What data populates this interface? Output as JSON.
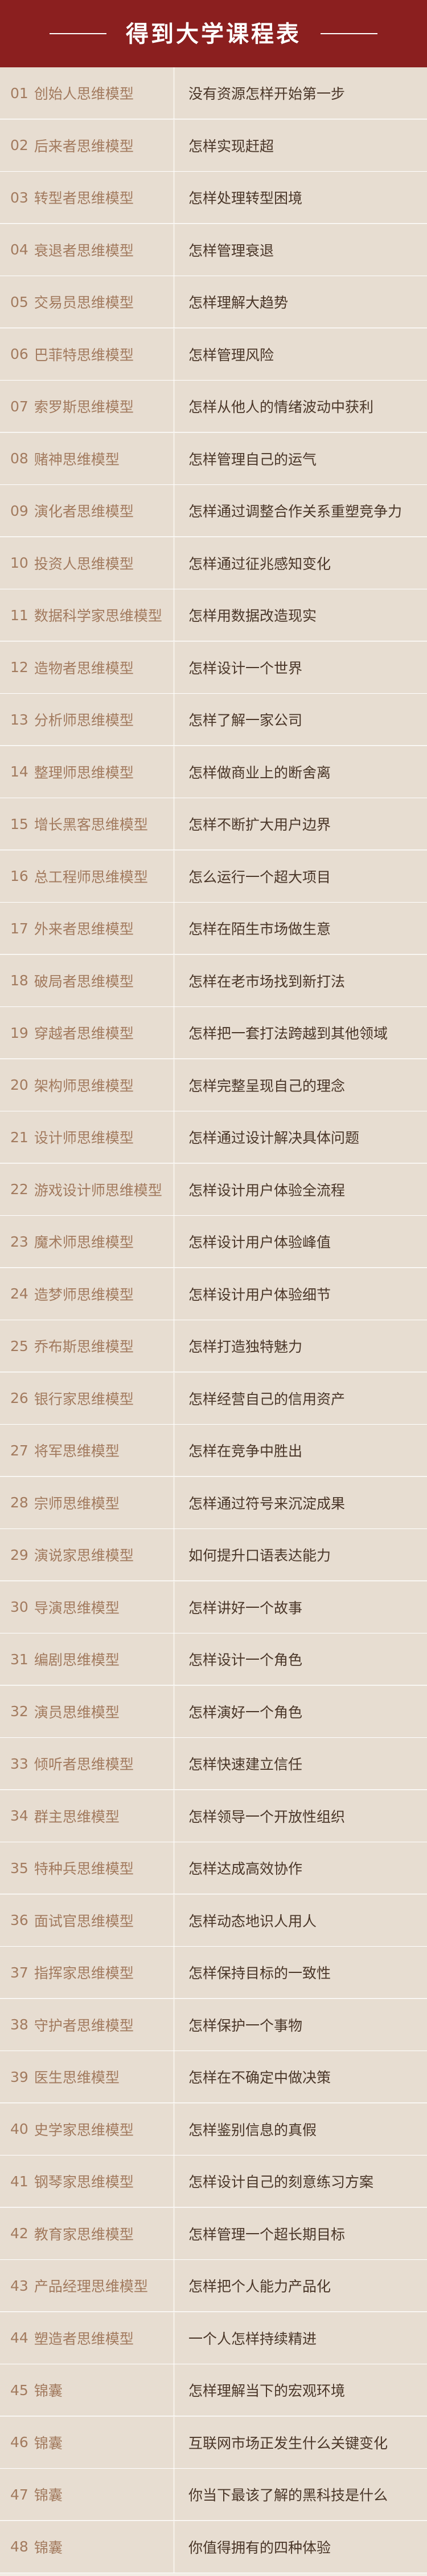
{
  "header": {
    "title": "得到大学课程表"
  },
  "courses": [
    {
      "num": "01",
      "model": "创始人思维模型",
      "desc": "没有资源怎样开始第一步"
    },
    {
      "num": "02",
      "model": "后来者思维模型",
      "desc": "怎样实现赶超"
    },
    {
      "num": "03",
      "model": "转型者思维模型",
      "desc": "怎样处理转型困境"
    },
    {
      "num": "04",
      "model": "衰退者思维模型",
      "desc": "怎样管理衰退"
    },
    {
      "num": "05",
      "model": "交易员思维模型",
      "desc": "怎样理解大趋势"
    },
    {
      "num": "06",
      "model": "巴菲特思维模型",
      "desc": "怎样管理风险"
    },
    {
      "num": "07",
      "model": "索罗斯思维模型",
      "desc": "怎样从他人的情绪波动中获利"
    },
    {
      "num": "08",
      "model": "赌神思维模型",
      "desc": "怎样管理自己的运气"
    },
    {
      "num": "09",
      "model": "演化者思维模型",
      "desc": "怎样通过调整合作关系重塑竞争力"
    },
    {
      "num": "10",
      "model": "投资人思维模型",
      "desc": "怎样通过征兆感知变化"
    },
    {
      "num": "11",
      "model": "数据科学家思维模型",
      "desc": "怎样用数据改造现实"
    },
    {
      "num": "12",
      "model": "造物者思维模型",
      "desc": "怎样设计一个世界"
    },
    {
      "num": "13",
      "model": "分析师思维模型",
      "desc": "怎样了解一家公司"
    },
    {
      "num": "14",
      "model": "整理师思维模型",
      "desc": "怎样做商业上的断舍离"
    },
    {
      "num": "15",
      "model": "增长黑客思维模型",
      "desc": "怎样不断扩大用户边界"
    },
    {
      "num": "16",
      "model": "总工程师思维模型",
      "desc": "怎么运行一个超大项目"
    },
    {
      "num": "17",
      "model": "外来者思维模型",
      "desc": "怎样在陌生市场做生意"
    },
    {
      "num": "18",
      "model": "破局者思维模型",
      "desc": "怎样在老市场找到新打法"
    },
    {
      "num": "19",
      "model": "穿越者思维模型",
      "desc": "怎样把一套打法跨越到其他领域"
    },
    {
      "num": "20",
      "model": "架构师思维模型",
      "desc": "怎样完整呈现自己的理念"
    },
    {
      "num": "21",
      "model": "设计师思维模型",
      "desc": "怎样通过设计解决具体问题"
    },
    {
      "num": "22",
      "model": "游戏设计师思维模型",
      "desc": "怎样设计用户体验全流程"
    },
    {
      "num": "23",
      "model": "魔术师思维模型",
      "desc": "怎样设计用户体验峰值"
    },
    {
      "num": "24",
      "model": "造梦师思维模型",
      "desc": "怎样设计用户体验细节"
    },
    {
      "num": "25",
      "model": "乔布斯思维模型",
      "desc": "怎样打造独特魅力"
    },
    {
      "num": "26",
      "model": "银行家思维模型",
      "desc": "怎样经营自己的信用资产"
    },
    {
      "num": "27",
      "model": "将军思维模型",
      "desc": "怎样在竞争中胜出"
    },
    {
      "num": "28",
      "model": "宗师思维模型",
      "desc": "怎样通过符号来沉淀成果"
    },
    {
      "num": "29",
      "model": "演说家思维模型",
      "desc": "如何提升口语表达能力"
    },
    {
      "num": "30",
      "model": "导演思维模型",
      "desc": "怎样讲好一个故事"
    },
    {
      "num": "31",
      "model": "编剧思维模型",
      "desc": "怎样设计一个角色"
    },
    {
      "num": "32",
      "model": "演员思维模型",
      "desc": "怎样演好一个角色"
    },
    {
      "num": "33",
      "model": "倾听者思维模型",
      "desc": "怎样快速建立信任"
    },
    {
      "num": "34",
      "model": "群主思维模型",
      "desc": "怎样领导一个开放性组织"
    },
    {
      "num": "35",
      "model": "特种兵思维模型",
      "desc": "怎样达成高效协作"
    },
    {
      "num": "36",
      "model": "面试官思维模型",
      "desc": "怎样动态地识人用人"
    },
    {
      "num": "37",
      "model": "指挥家思维模型",
      "desc": "怎样保持目标的一致性"
    },
    {
      "num": "38",
      "model": "守护者思维模型",
      "desc": "怎样保护一个事物"
    },
    {
      "num": "39",
      "model": "医生思维模型",
      "desc": "怎样在不确定中做决策"
    },
    {
      "num": "40",
      "model": "史学家思维模型",
      "desc": "怎样鉴别信息的真假"
    },
    {
      "num": "41",
      "model": "钢琴家思维模型",
      "desc": "怎样设计自己的刻意练习方案"
    },
    {
      "num": "42",
      "model": "教育家思维模型",
      "desc": "怎样管理一个超长期目标"
    },
    {
      "num": "43",
      "model": "产品经理思维模型",
      "desc": "怎样把个人能力产品化"
    },
    {
      "num": "44",
      "model": "塑造者思维模型",
      "desc": "一个人怎样持续精进"
    },
    {
      "num": "45",
      "model": "锦囊",
      "desc": "怎样理解当下的宏观环境"
    },
    {
      "num": "46",
      "model": "锦囊",
      "desc": "互联网市场正发生什么关键变化"
    },
    {
      "num": "47",
      "model": "锦囊",
      "desc": "你当下最该了解的黑科技是什么"
    },
    {
      "num": "48",
      "model": "锦囊",
      "desc": "你值得拥有的四种体验"
    }
  ]
}
